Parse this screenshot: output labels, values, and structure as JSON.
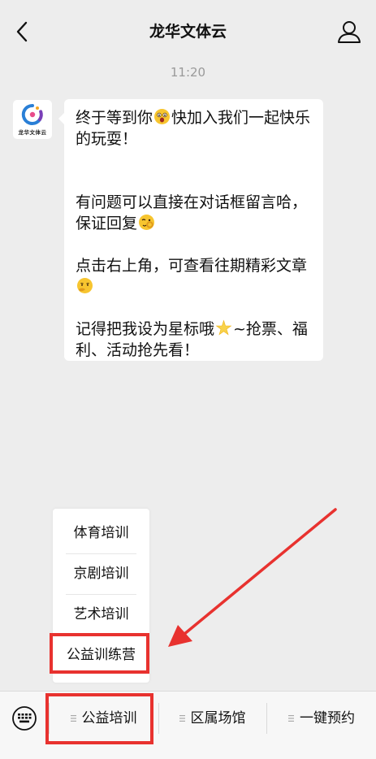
{
  "header": {
    "title": "龙华文体云",
    "back_icon": "chevron-left-icon",
    "profile_icon": "person-icon"
  },
  "chat": {
    "time": "11:20",
    "avatar_label": "龙华文体云",
    "message": {
      "line1a": "终于等到你",
      "line1b": "快加入我们一起快乐的玩耍！",
      "para2": "有问题可以直接在对话框留言哈，保证回复",
      "para3": "点击右上角，可查看往期精彩文章",
      "para4a": "记得把我设为星标哦",
      "para4b": "~抢票、福利、活动抢先看！"
    }
  },
  "popup_menu": {
    "items": [
      "体育培训",
      "京剧培训",
      "艺术培训",
      "公益训练营"
    ],
    "highlighted_item": "公益训练营"
  },
  "bottom_menu": {
    "keyboard_icon": "keyboard-icon",
    "items": [
      "公益培训",
      "区属场馆",
      "一键预约"
    ],
    "highlighted_item": "公益培训"
  },
  "colors": {
    "background": "#ededed",
    "bubble": "#ffffff",
    "annotation_red": "#e8322f"
  }
}
